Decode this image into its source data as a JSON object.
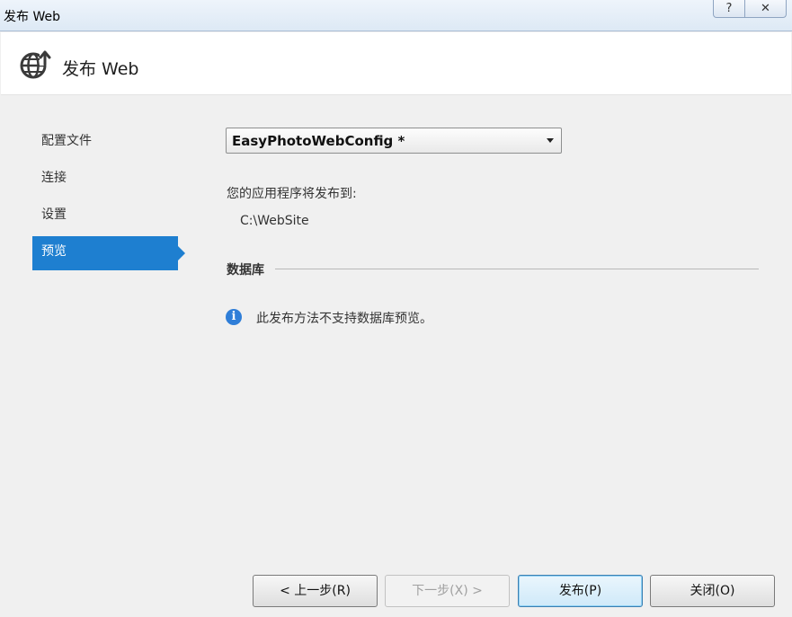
{
  "window": {
    "title": "发布 Web",
    "help_glyph": "?",
    "close_glyph": "✕"
  },
  "header": {
    "title": "发布 Web",
    "icon": "globe-publish-icon"
  },
  "nav": {
    "items": [
      {
        "label": "配置文件",
        "active": false
      },
      {
        "label": "连接",
        "active": false
      },
      {
        "label": "设置",
        "active": false
      },
      {
        "label": "预览",
        "active": true
      }
    ]
  },
  "main": {
    "profile_value": "EasyPhotoWebConfig *",
    "destination_label": "您的应用程序将发布到:",
    "destination_path": "C:\\WebSite",
    "database_section_title": "数据库",
    "info_text": "此发布方法不支持数据库预览。",
    "info_icon": "info-icon"
  },
  "buttons": {
    "prev": "< 上一步(R)",
    "next": "下一步(X) >",
    "publish": "发布(P)",
    "close": "关闭(O)"
  },
  "colors": {
    "accent": "#1e7fd0",
    "info": "#2f7ed8"
  }
}
